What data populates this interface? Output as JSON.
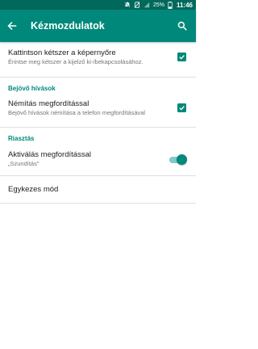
{
  "status_bar": {
    "battery_percent": "25%",
    "time": "11:46",
    "icons": [
      "silent-mode-icon",
      "no-sim-icon",
      "signal-icon",
      "battery-icon"
    ]
  },
  "app_bar": {
    "title": "Kézmozdulatok",
    "back_icon": "arrow-back-icon",
    "search_icon": "search-icon"
  },
  "prefs": {
    "double_tap": {
      "title": "Kattintson kétszer a képernyőre",
      "summary": "Érintse meg kétszer a kijelző ki-/bekapcsolásához.",
      "checked": true
    },
    "incoming_calls_category": "Bejövő hívások",
    "mute_flip": {
      "title": "Némítás megfordítással",
      "summary": "Bejövő hívások némítása a telefon megfordításával",
      "checked": true
    },
    "alarm_category": "Riasztás",
    "activate_flip": {
      "title": "Aktiválás megfordítással",
      "summary": "„Szundítás”",
      "enabled": true
    },
    "one_hand": {
      "title": "Egykezes mód"
    }
  },
  "colors": {
    "accent": "#00897b",
    "status_bar": "#00695c",
    "toggle_track": "#80cbc4"
  }
}
